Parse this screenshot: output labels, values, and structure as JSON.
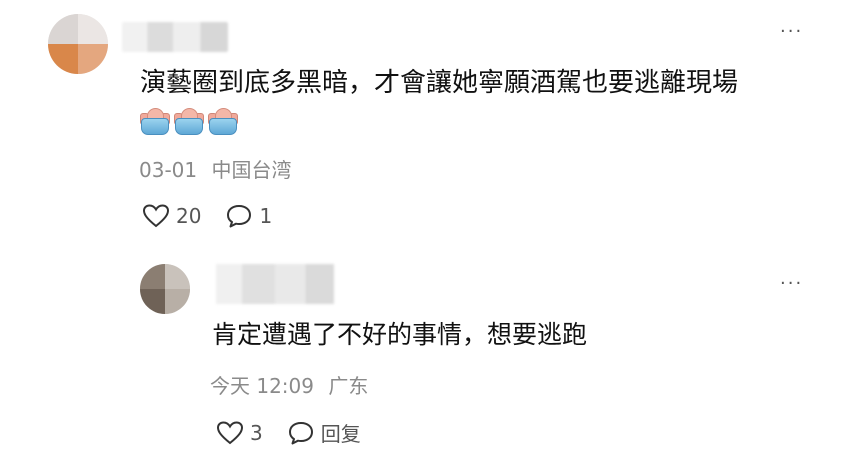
{
  "comment": {
    "text": "演藝圈到底多黑暗，才會讓她寧願酒駕也要逃離現場",
    "emojis": [
      "bathtub-emoji",
      "bathtub-emoji",
      "bathtub-emoji"
    ],
    "date": "03-01",
    "location": "中国台湾",
    "likes": "20",
    "replies": "1"
  },
  "reply": {
    "text": "肯定遭遇了不好的事情，想要逃跑",
    "time": "今天 12:09",
    "location": "广东",
    "likes": "3",
    "reply_label": "回复"
  }
}
